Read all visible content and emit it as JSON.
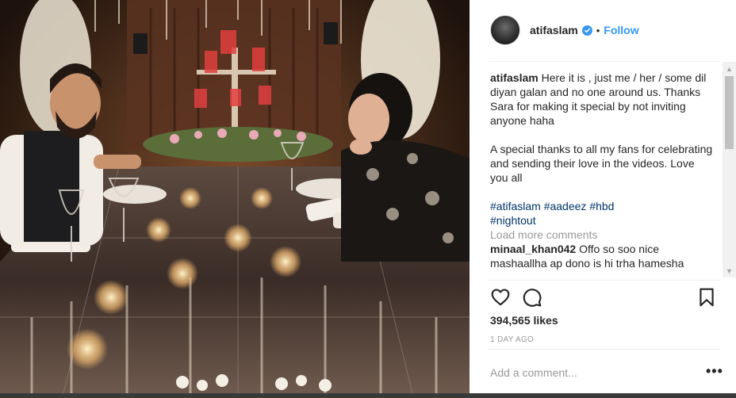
{
  "post": {
    "username": "atifaslam",
    "separator": "•",
    "follow_label": "Follow",
    "caption_user": "atifaslam",
    "caption_line1": "Here it is , just me / her / some dil diyan galan and no one around us. Thanks Sara for making it special by not inviting anyone haha",
    "caption_line2": "A special thanks to all my fans for celebrating and sending their love in the videos. Love you all",
    "hashtags": [
      "#atifaslam",
      "#aadeez",
      "#hbd",
      "#nightout"
    ],
    "load_more": "Load more comments",
    "comment": {
      "user": "minaal_khan042",
      "text": "Offo so soo nice mashaallha ap dono is hi trha hamesha"
    },
    "likes": "394,565 likes",
    "time": "1 DAY AGO",
    "add_comment_placeholder": "Add a comment...",
    "more_label": "•••"
  },
  "colors": {
    "link_blue": "#3897f0",
    "hashtag": "#003569",
    "muted": "#999999",
    "text": "#262626"
  },
  "icons": {
    "verified": "verified-badge-icon",
    "like": "heart-icon",
    "comment": "comment-bubble-icon",
    "save": "bookmark-icon",
    "scroll_up": "chevron-up-icon",
    "scroll_down": "chevron-down-icon"
  }
}
